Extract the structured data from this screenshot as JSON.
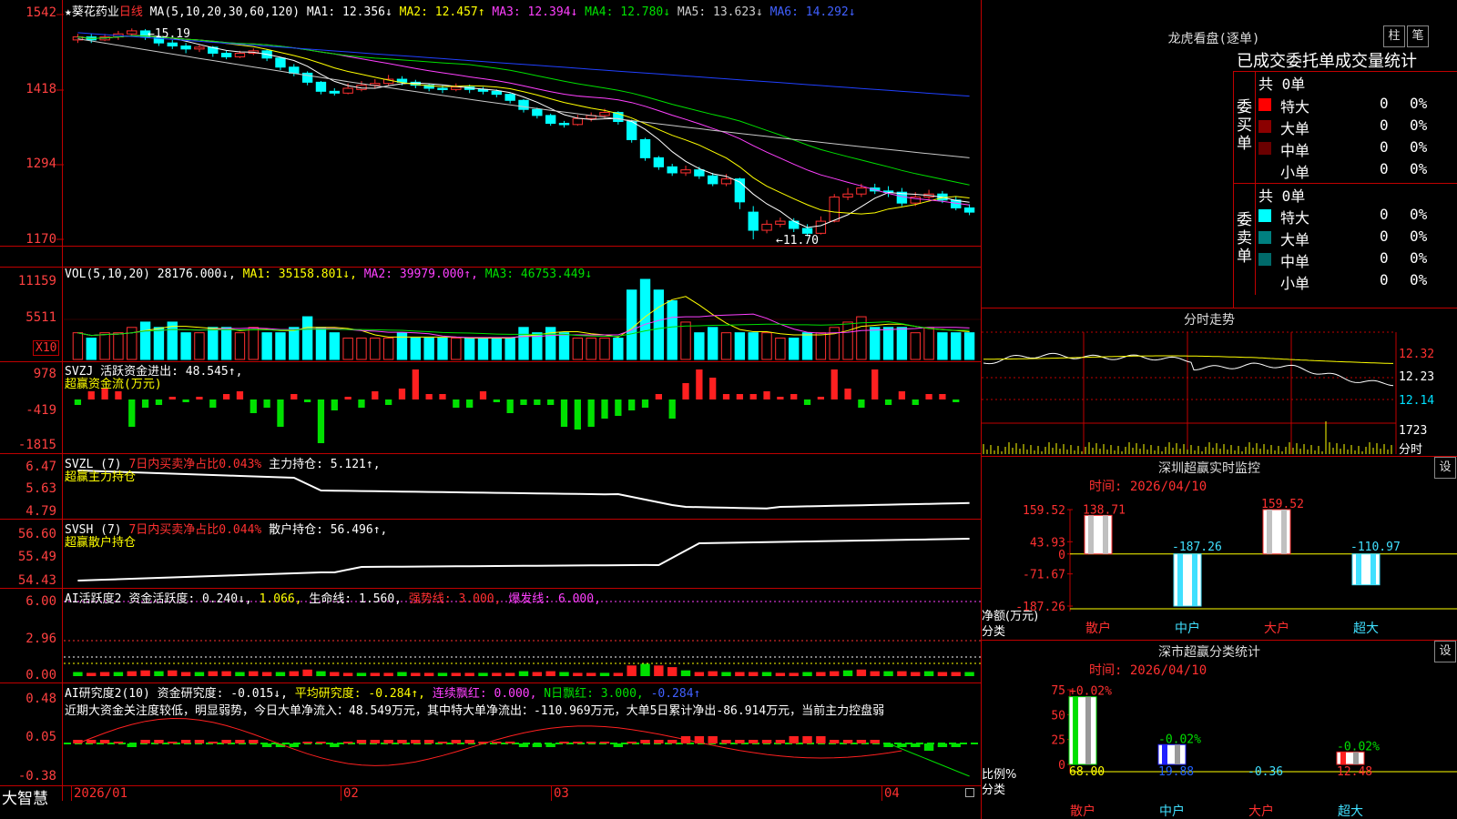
{
  "header": {
    "stock_name": "★葵花药业",
    "period": "日线",
    "ma_label": "MA(5,10,20,30,60,120)",
    "ma1": "MA1: 12.356↓",
    "ma2": "MA2: 12.457↑",
    "ma3": "MA3: 12.394↓",
    "ma4": "MA4: 12.780↓",
    "ma5": "MA5: 13.623↓",
    "ma6": "MA6: 14.292↓",
    "high_note": "←15.19",
    "low_note": "←11.70"
  },
  "price_axis": [
    "1542",
    "1418",
    "1294",
    "1170"
  ],
  "vol": {
    "label": "VOL(5,10,20)",
    "value": "28176.000↓,",
    "ma1": "MA1: 35158.801↓,",
    "ma2": "MA2: 39979.000↑,",
    "ma3": "MA3: 46753.449↓",
    "axis": [
      "11159",
      "5511"
    ],
    "unit": "X10"
  },
  "svzj": {
    "label": "SVZJ",
    "text": "活跃资金进出: 48.545↑,",
    "sub": "超赢资金流(万元)",
    "axis": [
      "978",
      "-419",
      "-1815"
    ]
  },
  "svzl": {
    "label": "SVZL (7)",
    "text1": "7日内买卖净占比0.043%",
    "text2": "主力持仓: 5.121↑,",
    "sub": "超赢主力持仓",
    "axis": [
      "6.47",
      "5.63",
      "4.79"
    ]
  },
  "svsh": {
    "label": "SVSH (7)",
    "text1": "7日内买卖净占比0.044%",
    "text2": "散户持仓: 56.496↑,",
    "sub": "超赢散户持仓",
    "axis": [
      "56.60",
      "55.49",
      "54.43"
    ]
  },
  "ai1": {
    "label": "AI活跃度2",
    "t1": "资金活跃度: 0.240↓,",
    "t2": "1.066,",
    "t3": "生命线: 1.560,",
    "t4": "强势线: 3.000,",
    "t5": "爆发线: 6.000,",
    "axis": [
      "6.00",
      "2.96",
      "0.00"
    ]
  },
  "ai2": {
    "label": "AI研究度2(10)",
    "t1": "资金研究度: -0.015↓,",
    "t2": "平均研究度: -0.284↑,",
    "t3": "连续飘红: 0.000,",
    "t4": "N日飘红: 3.000,",
    "t5": "-0.284↑",
    "comment": "近期大资金关注度较低，明显弱势，今日大单净流入：48.549万元，其中特大单净流出：-110.969万元，大单5日累计净出-86.914万元，当前主力控盘弱",
    "axis": [
      "0.48",
      "0.05",
      "-0.38"
    ]
  },
  "xaxis": {
    "brand": "大智慧",
    "labels": [
      "2026/01",
      "02",
      "03",
      "04"
    ]
  },
  "lhb": {
    "title": "龙虎看盘(逐单)",
    "btn1": "柱",
    "btn2": "笔",
    "subtitle": "已成交委托单成交量统计",
    "buy_label": "委买单",
    "buy_total": "共 0单",
    "sell_label": "委卖单",
    "sell_total": "共 0单",
    "buy_rows": [
      {
        "name": "特大",
        "count": "0",
        "pct": "0%",
        "color": "#ff0000"
      },
      {
        "name": "大单",
        "count": "0",
        "pct": "0%",
        "color": "#8b0000"
      },
      {
        "name": "中单",
        "count": "0",
        "pct": "0%",
        "color": "#6a0000"
      },
      {
        "name": "小单",
        "count": "0",
        "pct": "0%",
        "color": "#000000"
      }
    ],
    "sell_rows": [
      {
        "name": "特大",
        "count": "0",
        "pct": "0%",
        "color": "#00ffff"
      },
      {
        "name": "大单",
        "count": "0",
        "pct": "0%",
        "color": "#008080"
      },
      {
        "name": "中单",
        "count": "0",
        "pct": "0%",
        "color": "#006a6a"
      },
      {
        "name": "小单",
        "count": "0",
        "pct": "0%",
        "color": "#000000"
      }
    ]
  },
  "intraday": {
    "title": "分时走势",
    "price_labels": [
      "12.32",
      "12.23",
      "12.14"
    ],
    "vol_label": "1723",
    "time_label": "分时"
  },
  "sz_monitor": {
    "title": "深圳超赢实时监控",
    "btn": "设",
    "time": "时间: 2026/04/10",
    "axis": [
      "159.52",
      "43.93",
      "0",
      "-71.67",
      "-187.26"
    ],
    "ylabel1": "净额(万元)",
    "ylabel2": "分类",
    "bars": [
      {
        "cat": "散户",
        "value": 138.71,
        "label": "138.71"
      },
      {
        "cat": "中户",
        "value": -187.26,
        "label": "-187.26"
      },
      {
        "cat": "大户",
        "value": 159.52,
        "label": "159.52"
      },
      {
        "cat": "超大",
        "value": -110.97,
        "label": "-110.97"
      }
    ]
  },
  "sz_stat": {
    "title": "深市超赢分类统计",
    "btn": "设",
    "time": "时间: 2026/04/10",
    "axis": [
      "75",
      "50",
      "25",
      "0"
    ],
    "ylabel1": "比例%",
    "ylabel2": "分类",
    "bars": [
      {
        "cat": "散户",
        "value": 68.0,
        "label": "68.00",
        "top": "+0.02%"
      },
      {
        "cat": "中户",
        "value": 19.88,
        "label": "19.88",
        "top": "-0.02%"
      },
      {
        "cat": "大户",
        "value": -0.36,
        "label": "-0.36",
        "top": ""
      },
      {
        "cat": "超大",
        "value": 12.48,
        "label": "12.48",
        "top": "-0.02%"
      }
    ]
  },
  "colors": {
    "up": "#ff3030",
    "down": "#00ffff",
    "border": "#c00000"
  },
  "candles": [
    [
      15.0,
      15.05,
      14.95,
      15.1
    ],
    [
      15.05,
      15.0,
      14.95,
      15.1
    ],
    [
      15.0,
      15.05,
      14.98,
      15.1
    ],
    [
      15.05,
      15.1,
      15.0,
      15.15
    ],
    [
      15.1,
      15.15,
      15.05,
      15.19
    ],
    [
      15.15,
      15.05,
      15.0,
      15.18
    ],
    [
      15.05,
      14.95,
      14.9,
      15.08
    ],
    [
      14.95,
      14.9,
      14.85,
      15.0
    ],
    [
      14.9,
      14.85,
      14.78,
      14.95
    ],
    [
      14.85,
      14.88,
      14.8,
      14.92
    ],
    [
      14.88,
      14.78,
      14.72,
      14.9
    ],
    [
      14.78,
      14.72,
      14.68,
      14.82
    ],
    [
      14.72,
      14.78,
      14.7,
      14.82
    ],
    [
      14.78,
      14.82,
      14.75,
      14.86
    ],
    [
      14.82,
      14.7,
      14.65,
      14.85
    ],
    [
      14.7,
      14.55,
      14.5,
      14.72
    ],
    [
      14.55,
      14.45,
      14.4,
      14.6
    ],
    [
      14.45,
      14.3,
      14.25,
      14.48
    ],
    [
      14.3,
      14.15,
      14.1,
      14.32
    ],
    [
      14.15,
      14.12,
      14.08,
      14.2
    ],
    [
      14.12,
      14.2,
      14.1,
      14.28
    ],
    [
      14.18,
      14.25,
      14.15,
      14.32
    ],
    [
      14.25,
      14.28,
      14.2,
      14.35
    ],
    [
      14.28,
      14.35,
      14.25,
      14.42
    ],
    [
      14.35,
      14.3,
      14.25,
      14.4
    ],
    [
      14.3,
      14.25,
      14.2,
      14.34
    ],
    [
      14.25,
      14.2,
      14.15,
      14.28
    ],
    [
      14.2,
      14.18,
      14.12,
      14.25
    ],
    [
      14.18,
      14.22,
      14.15,
      14.28
    ],
    [
      14.22,
      14.18,
      14.12,
      14.26
    ],
    [
      14.18,
      14.15,
      14.1,
      14.22
    ],
    [
      14.15,
      14.1,
      14.05,
      14.18
    ],
    [
      14.1,
      14.0,
      13.95,
      14.12
    ],
    [
      14.0,
      13.85,
      13.8,
      14.02
    ],
    [
      13.85,
      13.75,
      13.7,
      13.88
    ],
    [
      13.75,
      13.62,
      13.58,
      13.78
    ],
    [
      13.62,
      13.6,
      13.55,
      13.66
    ],
    [
      13.6,
      13.7,
      13.58,
      13.76
    ],
    [
      13.7,
      13.75,
      13.65,
      13.8
    ],
    [
      13.75,
      13.8,
      13.7,
      13.86
    ],
    [
      13.8,
      13.65,
      13.6,
      13.82
    ],
    [
      13.65,
      13.35,
      13.3,
      13.68
    ],
    [
      13.35,
      13.05,
      13.0,
      13.38
    ],
    [
      13.05,
      12.9,
      12.85,
      13.08
    ],
    [
      12.9,
      12.8,
      12.75,
      12.95
    ],
    [
      12.8,
      12.85,
      12.75,
      12.92
    ],
    [
      12.85,
      12.75,
      12.7,
      12.9
    ],
    [
      12.75,
      12.62,
      12.58,
      12.8
    ],
    [
      12.62,
      12.7,
      12.58,
      12.78
    ],
    [
      12.7,
      12.32,
      12.2,
      12.72
    ],
    [
      12.15,
      11.85,
      11.7,
      12.25
    ],
    [
      11.85,
      11.95,
      11.8,
      12.02
    ],
    [
      11.95,
      12.0,
      11.9,
      12.06
    ],
    [
      12.0,
      11.88,
      11.82,
      12.05
    ],
    [
      11.88,
      11.8,
      11.75,
      11.95
    ],
    [
      11.8,
      12.0,
      11.78,
      12.08
    ],
    [
      12.0,
      12.4,
      11.98,
      12.45
    ],
    [
      12.4,
      12.45,
      12.35,
      12.55
    ],
    [
      12.45,
      12.55,
      12.4,
      12.62
    ],
    [
      12.55,
      12.5,
      12.45,
      12.62
    ],
    [
      12.5,
      12.48,
      12.4,
      12.58
    ],
    [
      12.48,
      12.3,
      12.25,
      12.55
    ],
    [
      12.3,
      12.4,
      12.25,
      12.48
    ],
    [
      12.4,
      12.45,
      12.35,
      12.52
    ],
    [
      12.45,
      12.35,
      12.3,
      12.5
    ],
    [
      12.35,
      12.22,
      12.18,
      12.4
    ],
    [
      12.22,
      12.15,
      12.1,
      12.28
    ]
  ],
  "vols": [
    5,
    4,
    5,
    5,
    6,
    7,
    6,
    7,
    5,
    5,
    6,
    6,
    5,
    6,
    5,
    5,
    6,
    8,
    6,
    5,
    4,
    4,
    4,
    4,
    5,
    4,
    4,
    4,
    4,
    4,
    4,
    4,
    4,
    6,
    5,
    6,
    5,
    4,
    4,
    4,
    4,
    13,
    15,
    13,
    11,
    7,
    5,
    6,
    5,
    5,
    5,
    5,
    4,
    4,
    5,
    5,
    6,
    7,
    8,
    6,
    6,
    6,
    5,
    6,
    5,
    5,
    5
  ],
  "svzj_vals": [
    -2,
    3,
    4,
    3,
    -10,
    -3,
    -2,
    1,
    -1,
    1,
    -3,
    2,
    3,
    -5,
    -3,
    -10,
    2,
    -1,
    -16,
    -4,
    1,
    -3,
    3,
    -2,
    4,
    11,
    2,
    2,
    -3,
    -3,
    3,
    -1,
    -5,
    -2,
    -2,
    -2,
    -10,
    -11,
    -10,
    -7,
    -6,
    -4,
    -3,
    2,
    -7,
    6,
    11,
    8,
    2,
    2,
    2,
    3,
    1,
    2,
    -2,
    1,
    11,
    4,
    -3,
    11,
    -2,
    3,
    -2,
    2,
    2,
    -1
  ],
  "ai2_vals": [
    1,
    1,
    1,
    0,
    -1,
    1,
    1,
    0,
    1,
    1,
    0,
    1,
    1,
    1,
    -1,
    -1,
    -1,
    0,
    0,
    -1,
    0,
    1,
    1,
    1,
    1,
    1,
    1,
    0,
    1,
    1,
    0,
    0,
    0,
    -1,
    -1,
    -1,
    0,
    0,
    0,
    0,
    -1,
    0,
    1,
    1,
    1,
    2,
    2,
    2,
    1,
    1,
    1,
    1,
    1,
    2,
    2,
    2,
    1,
    1,
    1,
    1,
    -1,
    -1,
    -1,
    -2,
    -1,
    -1
  ]
}
